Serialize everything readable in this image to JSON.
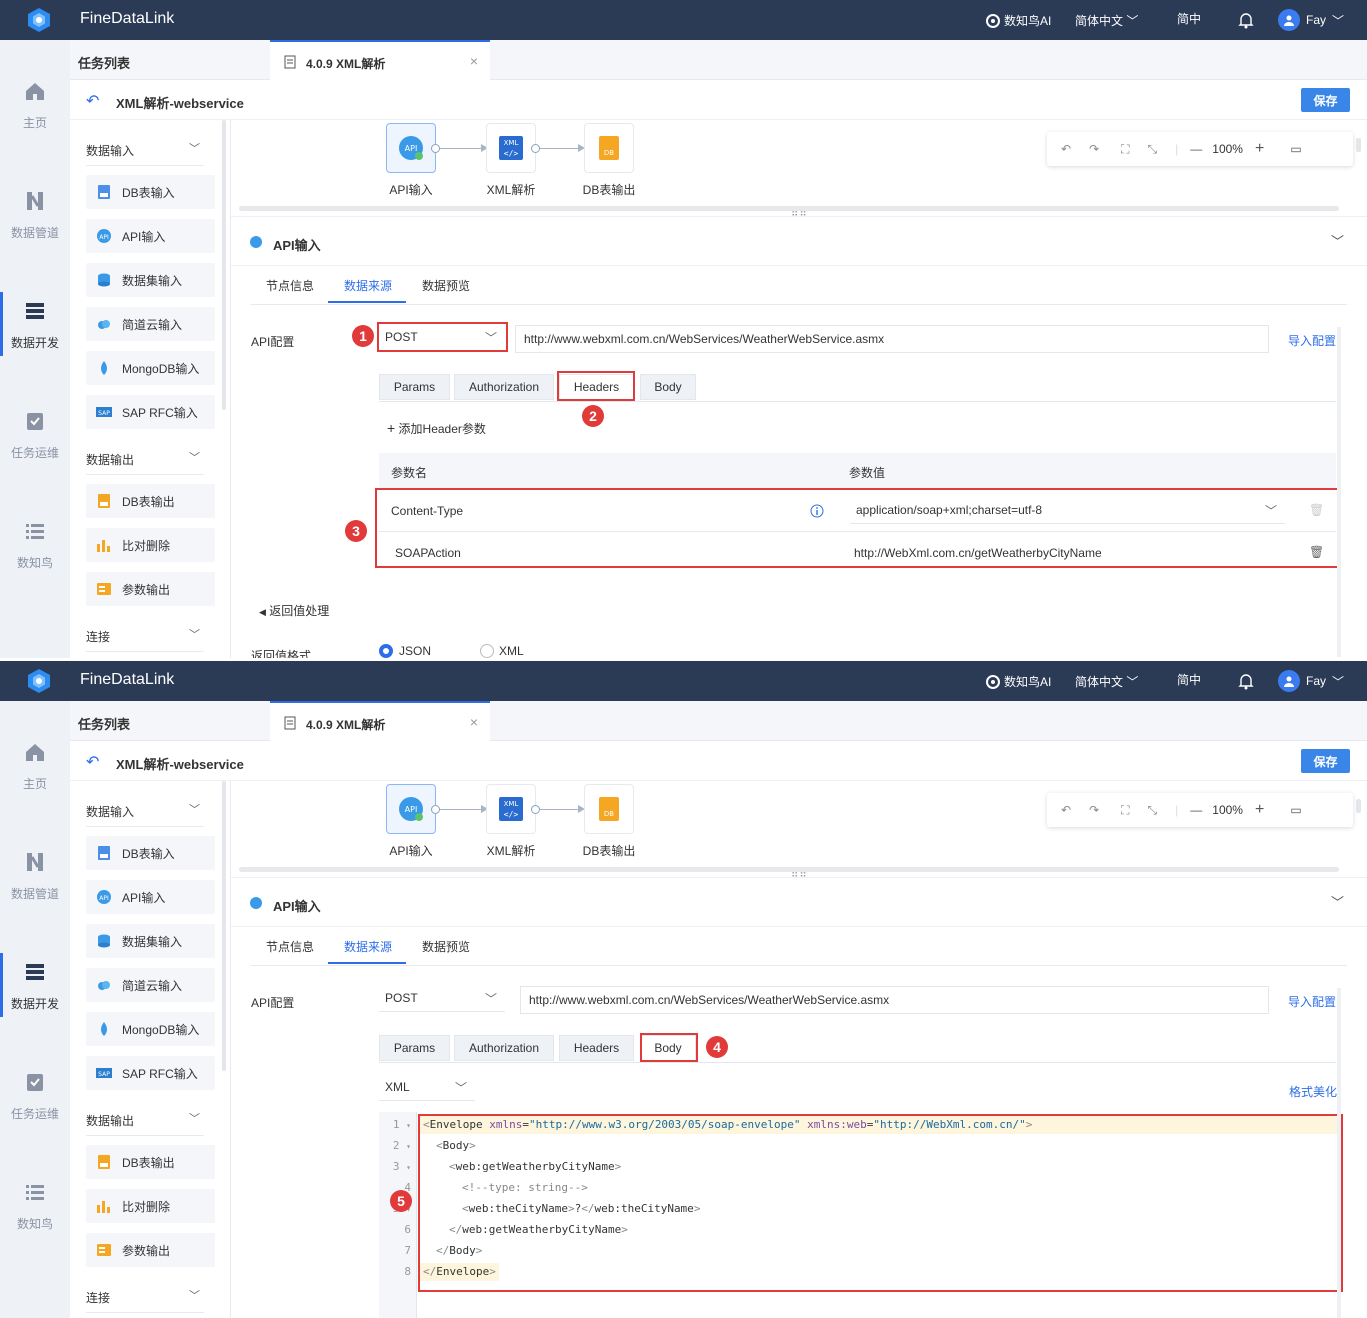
{
  "brand": {
    "name": "FineDataLink"
  },
  "topbar": {
    "ai_label": "数知鸟AI",
    "language": "简体中文",
    "lang_short": "简中",
    "user": "Fay"
  },
  "nav": {
    "items": [
      {
        "label": "主页",
        "icon": "home-icon"
      },
      {
        "label": "数据管道",
        "icon": "pipeline-icon"
      },
      {
        "label": "数据开发",
        "icon": "dev-icon"
      },
      {
        "label": "任务运维",
        "icon": "ops-icon"
      },
      {
        "label": "数知鸟",
        "icon": "list-icon"
      }
    ],
    "active": "数据开发"
  },
  "tabs": {
    "list_label": "任务列表",
    "active_tab": "4.0.9 XML解析"
  },
  "page": {
    "title": "XML解析-webservice",
    "save_label": "保存"
  },
  "sidebar": {
    "sections": [
      {
        "label": "数据输入",
        "items": [
          "DB表输入",
          "API输入",
          "数据集输入",
          "简道云输入",
          "MongoDB输入",
          "SAP RFC输入"
        ]
      },
      {
        "label": "数据输出",
        "items": [
          "DB表输出",
          "比对删除",
          "参数输出"
        ]
      },
      {
        "label": "连接",
        "items": []
      }
    ]
  },
  "flow": {
    "nodes": [
      {
        "label": "API输入",
        "icon": "api-icon"
      },
      {
        "label": "XML解析",
        "icon": "xml-icon"
      },
      {
        "label": "DB表输出",
        "icon": "db-output-icon"
      }
    ]
  },
  "toolbar": {
    "zoom": "100%"
  },
  "section": {
    "title": "API输入",
    "tabs": [
      "节点信息",
      "数据来源",
      "数据预览"
    ],
    "active_tab": "数据来源",
    "api_config_label": "API配置",
    "method": "POST",
    "url": "http://www.webxml.com.cn/WebServices/WeatherWebService.asmx",
    "import_label": "导入配置",
    "req_tabs": [
      "Params",
      "Authorization",
      "Headers",
      "Body"
    ]
  },
  "panel1": {
    "add_header": "添加Header参数",
    "col_name": "参数名",
    "col_value": "参数值",
    "headers": [
      {
        "name": "Content-Type",
        "value": "application/soap+xml;charset=utf-8"
      },
      {
        "name": "SOAPAction",
        "value": "http://WebXml.com.cn/getWeatherbyCityName"
      }
    ],
    "return_label": "返回值处理",
    "format_label": "返回值格式",
    "formats": [
      "JSON",
      "XML"
    ]
  },
  "panel2": {
    "body_type": "XML",
    "beautify": "格式美化",
    "code_lines": [
      {
        "n": "1",
        "fold": "▾"
      },
      {
        "n": "2",
        "fold": "▾"
      },
      {
        "n": "3",
        "fold": "▾"
      },
      {
        "n": "4",
        "fold": ""
      },
      {
        "n": "5",
        "fold": "▾"
      },
      {
        "n": "6",
        "fold": ""
      },
      {
        "n": "7",
        "fold": ""
      },
      {
        "n": "8",
        "fold": ""
      }
    ],
    "code": {
      "l1_tag": "Envelope",
      "l1_attr1": "xmlns",
      "l1_val1": "\"http://www.w3.org/2003/05/soap-envelope\"",
      "l1_attr2": "xmlns:web",
      "l1_val2": "\"http://WebXml.com.cn/\"",
      "l2": "Body",
      "l3": "web:getWeatherbyCityName",
      "l4": "<!--type: string-->",
      "l5_open": "web:theCityName",
      "l5_text": "?",
      "l5_close": "web:theCityName",
      "l6": "web:getWeatherbyCityName",
      "l7": "Body",
      "l8": "Envelope"
    }
  },
  "badges": [
    "1",
    "2",
    "3",
    "4",
    "5"
  ],
  "colors": {
    "topbar": "#2b3a55",
    "accent": "#2d6ee8",
    "annotation": "#e03a3a"
  }
}
